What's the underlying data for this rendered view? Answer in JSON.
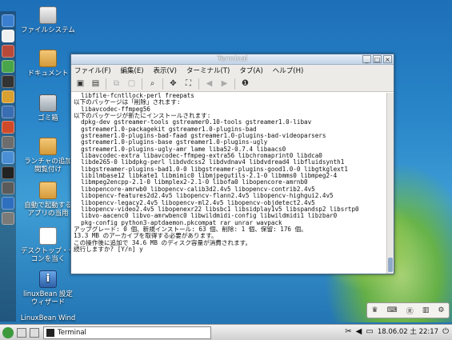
{
  "desktop": {
    "icons": [
      {
        "label": "ファイルシステム"
      },
      {
        "label": "ドキュメント"
      },
      {
        "label": "ゴミ箱"
      },
      {
        "label": "ランチャの追加\n閲覧付け"
      },
      {
        "label": "自動で起動する\nアプリの当用"
      },
      {
        "label": "デスクトップ・セ\nコンを当く"
      },
      {
        "label": "linuxBean 設定\nウィザード"
      },
      {
        "label": "LinuxBean Wind"
      }
    ]
  },
  "window": {
    "title": "Terminal",
    "menu": [
      "ファイル(F)",
      "編集(E)",
      "表示(V)",
      "ターミナル(T)",
      "タブ(A)",
      "ヘルプ(H)"
    ],
    "terminal_lines": [
      "  libfile-fcntllock-perl freepats",
      "以下のパッケージは「削除」されます:",
      "  libavcodec-ffmpeg56",
      "以下のパッケージが新たにインストールされます:",
      "  dpkg-dev gstreamer-tools gstreamer0.10-tools gstreamer1.0-libav",
      "  gstreamer1.0-packagekit gstreamer1.0-plugins-bad",
      "  gstreamer1.0-plugins-bad-faad gstreamer1.0-plugins-bad-videoparsers",
      "  gstreamer1.0-plugins-base gstreamer1.0-plugins-ugly",
      "  gstreamer1.0-plugins-ugly-amr lame liba52-0.7.4 libaacs0",
      "  libavcodec-extra libavcodec-ffmpeg-extra56 libchromaprint0 libdca0",
      "  libde265-0 libdpkg-perl libdvdcss2 libdvdnav4 libdvdread4 libfluidsynth1",
      "  libgstreamer-plugins-bad1.0-0 libgstreamer-plugins-good1.0-0 libgtkglext1",
      "  libilmbase12 libkate1 libmimic0 libmjpegutils-2.1-0 libmms0 libmpeg2-4",
      "  libmpeg2encpp-2.1-0 libmplex2-2.1-0 libofa0 libopencore-amrnb0",
      "  libopencore-amrwb0 libopencv-calib3d2.4v5 libopencv-contrib2.4v5",
      "  libopencv-features2d2.4v5 libopencv-flann2.4v5 libopencv-highgui2.4v5",
      "  libopencv-legacy2.4v5 libopencv-ml2.4v5 libopencv-objdetect2.4v5",
      "  libopencv-video2.4v5 libopenexr22 libsbc1 libsidplay1v5 libspandsp2 libsrtp0",
      "  libvo-aacenc0 libvo-amrwbenc0 libwildmidi-config libwildmidi1 libzbar0",
      "  pkg-config python3-aptdaemon.pkcompat rar unrar wavpack",
      "アップグレード: 0 個、新規インストール: 63 個、削除: 1 個、保留: 176 個。",
      "13.3 MB のアーカイブを取得する必要があります。",
      "この操作後に追加で 34.6 MB のディスク容量が消費されます。",
      "続行しますか? [Y/n] y"
    ]
  },
  "taskbar": {
    "task_label": "Terminal",
    "clock": "18.06.02 土 22:17"
  },
  "colors": {
    "desktop_blue": "#2a86c9",
    "titlebar": "#c2d3e7",
    "terminal_bg": "#ffffff"
  }
}
